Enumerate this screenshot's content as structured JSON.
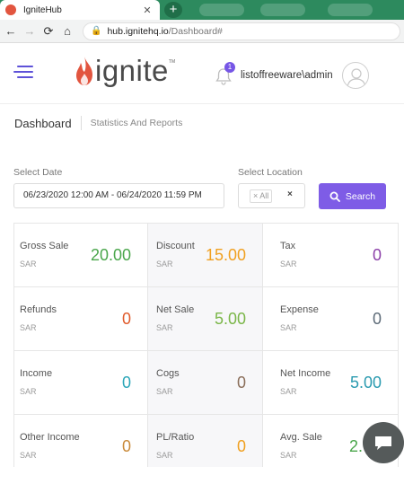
{
  "browser": {
    "tab_title": "IgniteHub",
    "url_domain": "hub.ignitehq.io",
    "url_path": "/Dashboard#"
  },
  "header": {
    "logo_text": "ignite",
    "logo_tm": "TM",
    "notification_count": "1",
    "user_name": "listoffreeware\\admin"
  },
  "breadcrumb": {
    "title": "Dashboard",
    "subtitle": "Statistics And Reports"
  },
  "filters": {
    "date_label": "Select Date",
    "date_value": "06/23/2020 12:00 AM - 06/24/2020 11:59 PM",
    "location_label": "Select Location",
    "location_chip": "All",
    "location_chip_remove": "×",
    "location_clear": "×",
    "search_label": "Search"
  },
  "stats": [
    {
      "label": "Gross Sale",
      "unit": "SAR",
      "value": "20.00",
      "color": "#4aa64b"
    },
    {
      "label": "Discount",
      "unit": "SAR",
      "value": "15.00",
      "color": "#f0a020"
    },
    {
      "label": "Tax",
      "unit": "SAR",
      "value": "0",
      "color": "#8b3fa8"
    },
    {
      "label": "Refunds",
      "unit": "SAR",
      "value": "0",
      "color": "#e05a2b"
    },
    {
      "label": "Net Sale",
      "unit": "SAR",
      "value": "5.00",
      "color": "#7ab648"
    },
    {
      "label": "Expense",
      "unit": "SAR",
      "value": "0",
      "color": "#5d6b78"
    },
    {
      "label": "Income",
      "unit": "SAR",
      "value": "0",
      "color": "#2ba6b8"
    },
    {
      "label": "Cogs",
      "unit": "SAR",
      "value": "0",
      "color": "#8a6e5a"
    },
    {
      "label": "Net Income",
      "unit": "SAR",
      "value": "5.00",
      "color": "#2b9bb0"
    },
    {
      "label": "Other Income",
      "unit": "SAR",
      "value": "0",
      "color": "#c98a3a"
    },
    {
      "label": "PL/Ratio",
      "unit": "SAR",
      "value": "0",
      "color": "#f0a020"
    },
    {
      "label": "Avg. Sale",
      "unit": "SAR",
      "value": "2.",
      "color": "#4aa64b"
    }
  ],
  "colors": {
    "accent": "#7e5ce6",
    "hamburger": "#5e52d8",
    "logo_flame": "#e2553f",
    "browser_tabstrip": "#2d8a5e"
  },
  "icons": {
    "menu": "hamburger-menu-icon",
    "bell": "bell-icon",
    "avatar": "user-avatar-icon",
    "search": "search-icon",
    "chat": "chat-bubble-icon"
  }
}
